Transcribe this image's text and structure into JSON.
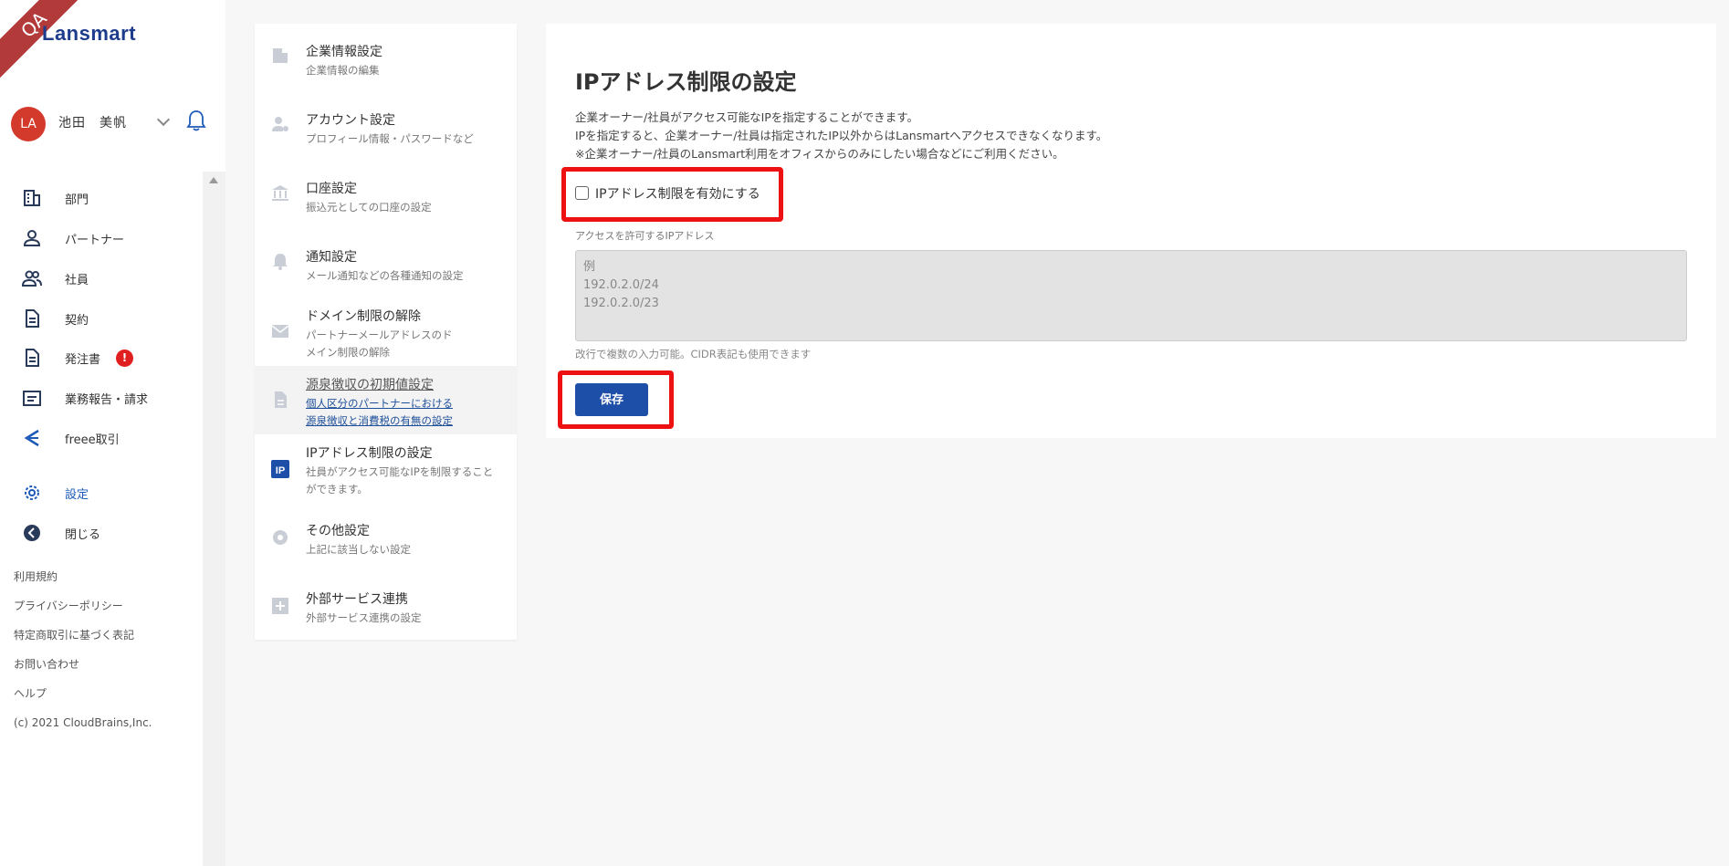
{
  "sidebar": {
    "ribbon": "QA",
    "logo": "Lansmart",
    "user": {
      "initials": "LA",
      "name": "池田　美帆"
    },
    "nav": [
      {
        "label": "部門"
      },
      {
        "label": "パートナー"
      },
      {
        "label": "社員"
      },
      {
        "label": "契約"
      },
      {
        "label": "発注書",
        "badge": "!"
      },
      {
        "label": "業務報告・請求"
      },
      {
        "label": "freee取引"
      },
      {
        "label": "設定"
      },
      {
        "label": "閉じる"
      }
    ],
    "footer_links": [
      "利用規約",
      "プライバシーポリシー",
      "特定商取引に基づく表記",
      "お問い合わせ",
      "ヘルプ"
    ],
    "copyright": "(c) 2021 CloudBrains,Inc."
  },
  "settings_menu": [
    {
      "title": "企業情報設定",
      "sub": "企業情報の編集",
      "icon": "building-icon"
    },
    {
      "title": "アカウント設定",
      "sub": "プロフィール情報・パスワードなど",
      "icon": "account-settings-icon"
    },
    {
      "title": "口座設定",
      "sub": "振込元としての口座の設定",
      "icon": "bank-icon"
    },
    {
      "title": "通知設定",
      "sub": "メール通知などの各種通知の設定",
      "icon": "bell-icon"
    },
    {
      "title": "ドメイン制限の解除",
      "sub": "パートナーメールアドレスのドメイン制限の解除",
      "icon": "mail-icon"
    },
    {
      "title": "源泉徴収の初期値設定",
      "sub": "個人区分のパートナーにおける源泉徴収と消費税の有無の設定",
      "icon": "document-icon"
    },
    {
      "title": "IPアドレス制限の設定",
      "sub": "社員がアクセス可能なIPを制限することができます。",
      "icon": "ip-icon"
    },
    {
      "title": "その他設定",
      "sub": "上記に該当しない設定",
      "icon": "gear-icon"
    },
    {
      "title": "外部サービス連携",
      "sub": "外部サービス連携の設定",
      "icon": "plus-box-icon"
    }
  ],
  "main": {
    "title": "IPアドレス制限の設定",
    "description": [
      "企業オーナー/社員がアクセス可能なIPを指定することができます。",
      "IPを指定すると、企業オーナー/社員は指定されたIP以外からはLansmartへアクセスできなくなります。",
      "※企業オーナー/社員のLansmart利用をオフィスからのみにしたい場合などにご利用ください。"
    ],
    "checkbox_label": "IPアドレス制限を有効にする",
    "field_label": "アクセスを許可するIPアドレス",
    "placeholder": "例\n192.0.2.0/24\n192.0.2.0/23",
    "hint": "改行で複数の入力可能。CIDR表記も使用できます",
    "save_label": "保存"
  },
  "colors": {
    "accent": "#1e4fa8",
    "highlight": "#e11111",
    "badge": "#e02020",
    "avatar": "#d33a2c"
  }
}
